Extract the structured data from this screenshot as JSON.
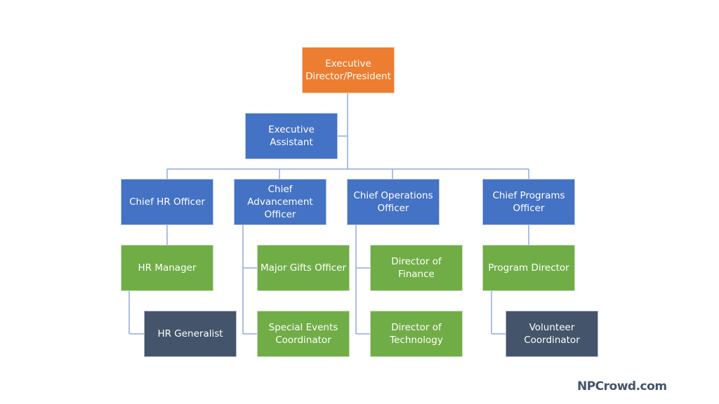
{
  "colors": {
    "executive": "#ED7D31",
    "chief": "#4472C4",
    "manager": "#70AD47",
    "staff": "#44546A",
    "connector": "#8FAADC"
  },
  "nodes": {
    "executive": {
      "label": "Executive Director/President",
      "level": "executive"
    },
    "assistant": {
      "label": "Executive Assistant",
      "level": "chief"
    },
    "chief_hr": {
      "label": "Chief HR Officer",
      "level": "chief"
    },
    "chief_adv": {
      "label": "Chief Advancement Officer",
      "level": "chief"
    },
    "chief_ops": {
      "label": "Chief Operations Officer",
      "level": "chief"
    },
    "chief_prog": {
      "label": "Chief Programs Officer",
      "level": "chief"
    },
    "hr_manager": {
      "label": "HR Manager",
      "level": "manager"
    },
    "major_gifts": {
      "label": "Major Gifts Officer",
      "level": "manager"
    },
    "dir_finance": {
      "label": "Director of Finance",
      "level": "manager"
    },
    "program_dir": {
      "label": "Program Director",
      "level": "manager"
    },
    "hr_generalist": {
      "label": "HR Generalist",
      "level": "staff"
    },
    "special_events": {
      "label": "Special Events Coordinator",
      "level": "manager"
    },
    "dir_tech": {
      "label": "Director of Technology",
      "level": "manager"
    },
    "volunteer": {
      "label": "Volunteer Coordinator",
      "level": "staff"
    }
  },
  "logo": "NPCrowd.com"
}
